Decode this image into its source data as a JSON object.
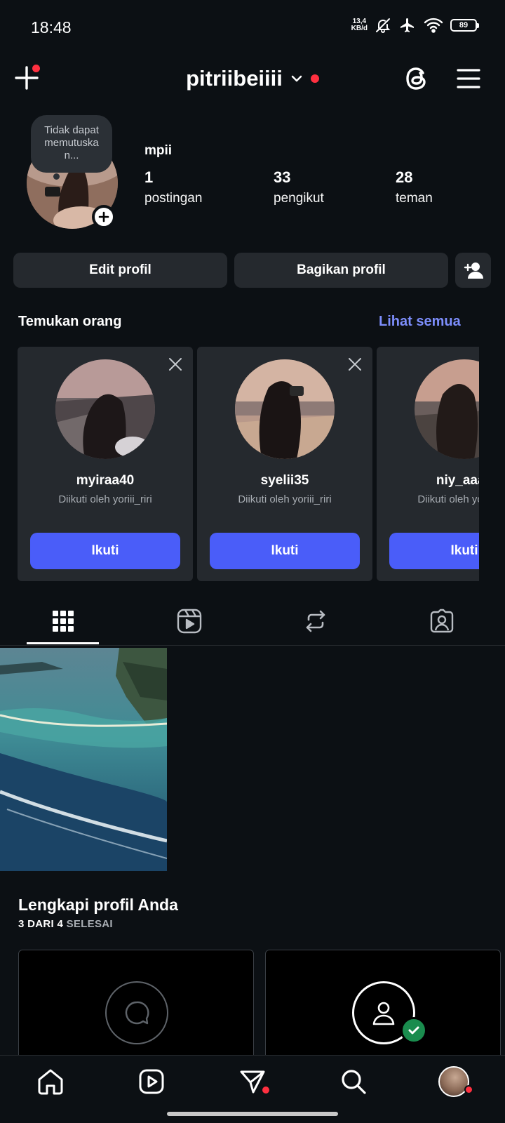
{
  "status_bar": {
    "time": "18:48",
    "net_speed_value": "13,4",
    "net_speed_unit": "KB/d",
    "battery": "89",
    "icons": [
      "bell-off-icon",
      "airplane-icon",
      "wifi-icon",
      "battery-icon"
    ]
  },
  "header": {
    "username": "pitriibeiiii",
    "icons": [
      "add-icon",
      "chevron-down-icon",
      "threads-icon",
      "menu-icon"
    ],
    "notification_color": "#ff3040"
  },
  "profile": {
    "note": "Tidak dapat memutuska n...",
    "display_name": "mpii",
    "stats": [
      {
        "value": "1",
        "label": "postingan"
      },
      {
        "value": "33",
        "label": "pengikut"
      },
      {
        "value": "28",
        "label": "teman"
      }
    ],
    "edit_button": "Edit profil",
    "share_button": "Bagikan profil"
  },
  "discover": {
    "title": "Temukan orang",
    "see_all": "Lihat semua",
    "accent_color": "#7d8efc",
    "cards": [
      {
        "username": "myiraa40",
        "subtitle": "Diikuti oleh yoriii_riri",
        "follow_label": "Ikuti"
      },
      {
        "username": "syelii35",
        "subtitle": "Diikuti oleh yoriii_riri",
        "follow_label": "Ikuti"
      },
      {
        "username": "niy_aaav",
        "subtitle": "Diikuti oleh yoriii_riri",
        "follow_label": "Ikuti"
      }
    ],
    "follow_color": "#4a5df9"
  },
  "tabs": {
    "items": [
      "grid-icon",
      "reels-icon",
      "reposts-icon",
      "tagged-icon"
    ],
    "active": "grid-icon"
  },
  "complete_profile": {
    "title": "Lengkapi profil Anda",
    "progress_done": "3 DARI 4",
    "progress_label": "SELESAI",
    "progress": {
      "completed": 3,
      "total": 4
    }
  },
  "bottom_nav": {
    "items": [
      "home-icon",
      "reels-icon",
      "messages-icon",
      "search-icon",
      "profile-avatar"
    ]
  }
}
